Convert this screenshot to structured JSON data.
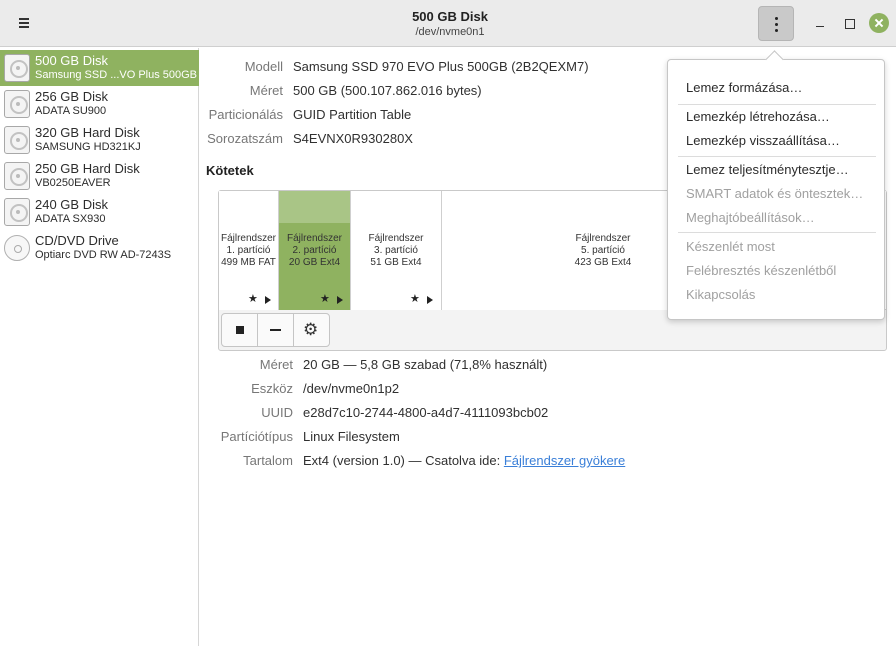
{
  "header": {
    "title": "500 GB Disk",
    "subtitle": "/dev/nvme0n1"
  },
  "sidebar": {
    "items": [
      {
        "name": "500 GB Disk",
        "sub": "Samsung SSD ...VO Plus 500GB",
        "icon": "disk-icon",
        "selected": true
      },
      {
        "name": "256 GB Disk",
        "sub": "ADATA SU900",
        "icon": "disk-icon"
      },
      {
        "name": "320 GB Hard Disk",
        "sub": "SAMSUNG HD321KJ",
        "icon": "disk-icon"
      },
      {
        "name": "250 GB Hard Disk",
        "sub": "VB0250EAVER",
        "icon": "disk-icon"
      },
      {
        "name": "240 GB Disk",
        "sub": "ADATA SX930",
        "icon": "disk-icon"
      },
      {
        "name": "CD/DVD Drive",
        "sub": "Optiarc DVD RW AD-7243S",
        "icon": "cd-icon"
      }
    ]
  },
  "disk_info": {
    "model_label": "Modell",
    "model_value": "Samsung SSD 970 EVO Plus 500GB (2B2QEXM7)",
    "size_label": "Méret",
    "size_value": "500 GB (500.107.862.016 bytes)",
    "partitioning_label": "Particionálás",
    "partitioning_value": "GUID Partition Table",
    "serial_label": "Sorozatszám",
    "serial_value": "S4EVNX0R930280X"
  },
  "volumes": {
    "title": "Kötetek",
    "partitions": [
      {
        "line1": "Fájlrendszer",
        "line2": "1. partíció",
        "line3": "499 MB FAT"
      },
      {
        "line1": "Fájlrendszer",
        "line2": "2. partíció",
        "line3": "20 GB Ext4",
        "selected": true
      },
      {
        "line1": "Fájlrendszer",
        "line2": "3. partíció",
        "line3": "51 GB Ext4"
      },
      {
        "line1": "Fájlrendszer",
        "line2": "5. partíció",
        "line3": "423 GB Ext4"
      }
    ]
  },
  "partition_info": {
    "size_label": "Méret",
    "size_value": "20 GB — 5,8 GB szabad (71,8% használt)",
    "device_label": "Eszköz",
    "device_value": "/dev/nvme0n1p2",
    "uuid_label": "UUID",
    "uuid_value": "e28d7c10-2744-4800-a4d7-4111093bcb02",
    "type_label": "Partíciótípus",
    "type_value": "Linux Filesystem",
    "content_label": "Tartalom",
    "content_value": "Ext4 (version 1.0) — Csatolva ide: ",
    "content_link": "Fájlrendszer gyökere"
  },
  "menu": {
    "items": [
      {
        "label": "Lemez formázása…",
        "enabled": true
      },
      {
        "label": "Lemezkép létrehozása…",
        "enabled": true
      },
      {
        "label": "Lemezkép visszaállítása…",
        "enabled": true
      },
      {
        "label": "Lemez teljesítménytesztje…",
        "enabled": true
      },
      {
        "label": "SMART adatok és öntesztek…",
        "enabled": false
      },
      {
        "label": "Meghajtóbeállítások…",
        "enabled": false
      },
      {
        "label": "Készenlét most",
        "enabled": false
      },
      {
        "label": "Felébresztés készenlétből",
        "enabled": false
      },
      {
        "label": "Kikapcsolás",
        "enabled": false
      }
    ]
  },
  "colors": {
    "accent": "#8fb260",
    "accent_light": "#a9c586",
    "link": "#3a7fd8"
  }
}
